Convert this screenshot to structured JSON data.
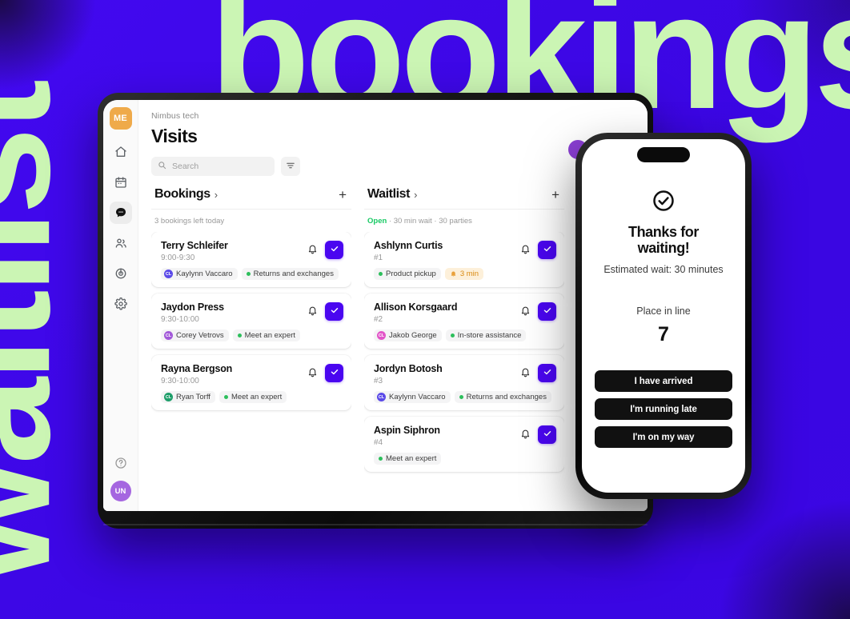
{
  "background": {
    "word_top": "bookings",
    "word_left": "waitlist",
    "accent_green": "#CBF5B4",
    "base_violet": "#3D07E6"
  },
  "tablet": {
    "rail": {
      "logo_initials": "ME",
      "items": [
        {
          "name": "home-icon",
          "label": "Home",
          "active": false
        },
        {
          "name": "calendar-icon",
          "label": "Calendar",
          "active": false
        },
        {
          "name": "chat-icon",
          "label": "Messages",
          "active": true
        },
        {
          "name": "people-icon",
          "label": "Customers",
          "active": false
        },
        {
          "name": "target-icon",
          "label": "Insights",
          "active": false
        },
        {
          "name": "gear-icon",
          "label": "Settings",
          "active": false
        }
      ],
      "help_label": "Help",
      "avatar_initials": "UN"
    },
    "header": {
      "org_name": "Nimbus tech",
      "page_title": "Visits"
    },
    "search": {
      "placeholder": "Search",
      "value": "",
      "filter_label": "Filter"
    },
    "columns": [
      {
        "title": "Bookings",
        "chevron": "›",
        "add_label": "+",
        "subtitle": "3 bookings left today",
        "status_prefix": "",
        "cards": [
          {
            "name": "Terry Schleifer",
            "meta": "9:00-9:30",
            "chips": [
              {
                "type": "avatar",
                "text": "Kaylynn Vaccaro",
                "initials": "CL",
                "color": "#5B4AE8"
              },
              {
                "type": "dot",
                "text": "Returns and exchanges",
                "color": "#2DBF5C"
              }
            ]
          },
          {
            "name": "Jaydon Press",
            "meta": "9:30-10:00",
            "chips": [
              {
                "type": "avatar",
                "text": "Corey Vetrovs",
                "initials": "CL",
                "color": "#A259D9"
              },
              {
                "type": "dot",
                "text": "Meet an expert",
                "color": "#2DBF5C"
              }
            ]
          },
          {
            "name": "Rayna Bergson",
            "meta": "9:30-10:00",
            "chips": [
              {
                "type": "avatar",
                "text": "Ryan Torff",
                "initials": "CL",
                "color": "#1E9E6A"
              },
              {
                "type": "dot",
                "text": "Meet an expert",
                "color": "#2DBF5C"
              }
            ]
          }
        ]
      },
      {
        "title": "Waitlist",
        "chevron": "›",
        "add_label": "+",
        "subtitle": " · 30 min wait · 30 parties",
        "status_prefix": "Open",
        "cards": [
          {
            "name": "Ashlynn Curtis",
            "meta": "#1",
            "chips": [
              {
                "type": "dot",
                "text": "Product pickup",
                "color": "#2DBF5C"
              },
              {
                "type": "warn",
                "text": "3 min",
                "color": "#E9A13B"
              }
            ]
          },
          {
            "name": "Allison Korsgaard",
            "meta": "#2",
            "chips": [
              {
                "type": "avatar",
                "text": "Jakob George",
                "initials": "CL",
                "color": "#E255C8"
              },
              {
                "type": "dot",
                "text": "In-store assistance",
                "color": "#2DBF5C"
              }
            ]
          },
          {
            "name": "Jordyn Botosh",
            "meta": "#3",
            "chips": [
              {
                "type": "avatar",
                "text": "Kaylynn Vaccaro",
                "initials": "CL",
                "color": "#5B4AE8"
              },
              {
                "type": "dot",
                "text": "Returns and exchanges",
                "color": "#2DBF5C"
              }
            ]
          },
          {
            "name": "Aspin Siphron",
            "meta": "#4",
            "chips": [
              {
                "type": "dot",
                "text": "Meet an expert",
                "color": "#2DBF5C"
              }
            ]
          }
        ]
      }
    ]
  },
  "phone": {
    "title": "Thanks for waiting!",
    "wait_text": "Estimated wait: 30 minutes",
    "place_label": "Place in line",
    "place_number": "7",
    "buttons": [
      "I have arrived",
      "I'm running late",
      "I'm on my way"
    ]
  }
}
